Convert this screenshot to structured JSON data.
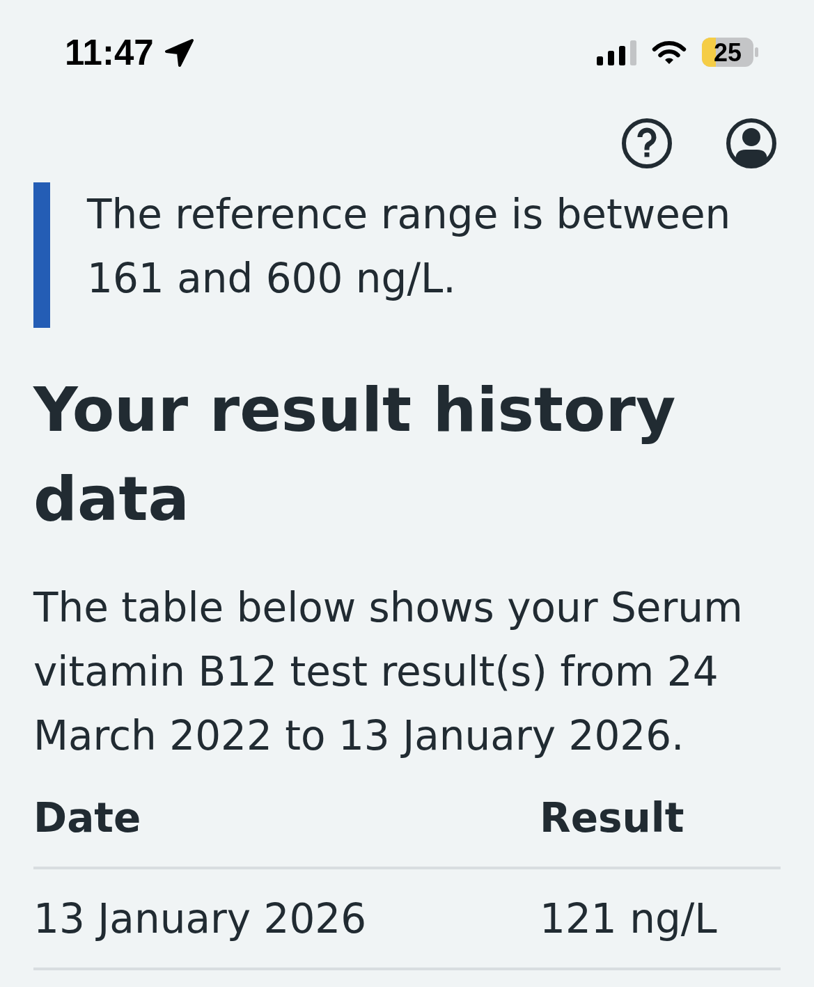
{
  "status_bar": {
    "time": "11:47",
    "battery": "25"
  },
  "inset_text": "The reference range is between 161 and 600 ng/L.",
  "heading": "Your result history data",
  "intro": "The table below shows your Serum vitamin B12 test result(s) from 24 March 2022 to 13 January 2026.",
  "table": {
    "columns": [
      "Date",
      "Result"
    ],
    "rows": [
      [
        "13 January 2026",
        "121 ng/L"
      ]
    ]
  }
}
